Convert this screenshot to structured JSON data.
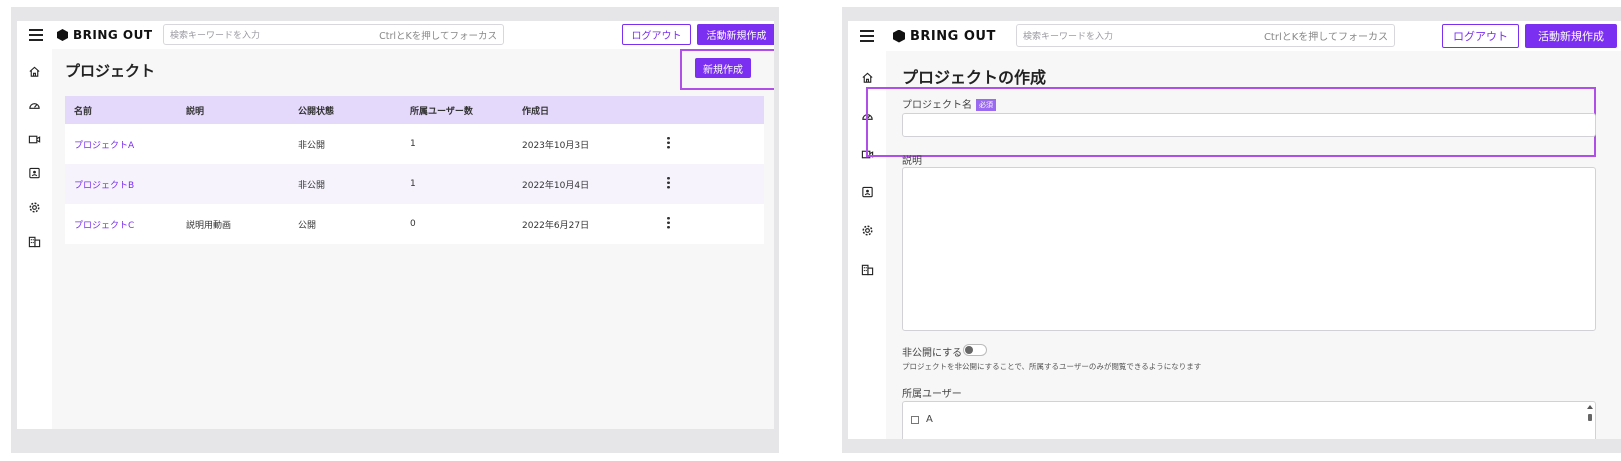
{
  "header": {
    "brand": "BRING OUT",
    "search_placeholder": "検索キーワードを入力",
    "search_hint": "CtrlとKを押してフォーカス",
    "logout_label": "ログアウト",
    "create_activity_label": "活動新規作成"
  },
  "sidebar": {
    "icons": [
      "home-icon",
      "dashboard-icon",
      "video-icon",
      "user-badge-icon",
      "gear-icon",
      "building-icon"
    ]
  },
  "left_panel": {
    "title": "プロジェクト",
    "new_button_label": "新規作成",
    "table": {
      "columns": [
        "名前",
        "説明",
        "公開状態",
        "所属ユーザー数",
        "作成日"
      ],
      "rows": [
        {
          "name": "プロジェクトA",
          "description": "",
          "status": "非公開",
          "members": "1",
          "created": "2023年10月3日"
        },
        {
          "name": "プロジェクトB",
          "description": "",
          "status": "非公開",
          "members": "1",
          "created": "2022年10月4日"
        },
        {
          "name": "プロジェクトC",
          "description": "説明用動画",
          "status": "公開",
          "members": "0",
          "created": "2022年6月27日"
        }
      ]
    }
  },
  "right_panel": {
    "title": "プロジェクトの作成",
    "project_name_label": "プロジェクト名",
    "required_badge": "必須",
    "description_label": "説明",
    "private_toggle_label": "非公開にする",
    "private_help_text": "プロジェクトを非公開にすることで、所属するユーザーのみが閲覧できるようになります",
    "members_label": "所属ユーザー",
    "members_first_option": "A"
  },
  "colors": {
    "accent": "#7b2ff0",
    "highlight": "#b04ee8",
    "table_header": "#e4d8fb"
  }
}
